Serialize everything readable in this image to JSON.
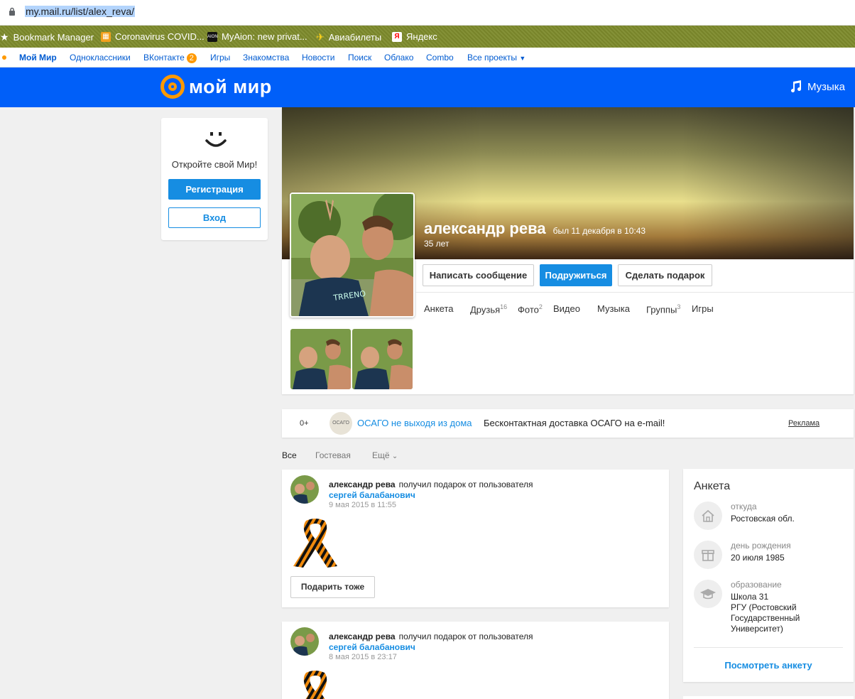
{
  "browser": {
    "url": "my.mail.ru/list/alex_reva/",
    "bookmarks": [
      {
        "label": "Bookmark Manager",
        "icon": "star-icon"
      },
      {
        "label": "Coronavirus COVID...",
        "icon": "covid-icon"
      },
      {
        "label": "MyAion: new privat...",
        "icon": "aion-icon"
      },
      {
        "label": "Авиабилеты",
        "icon": "plane-icon"
      },
      {
        "label": "Яндекс",
        "icon": "yandex-icon"
      }
    ]
  },
  "portal": {
    "links": [
      "Мой Мир",
      "Одноклассники",
      "ВКонтакте",
      "Игры",
      "Знакомства",
      "Новости",
      "Поиск",
      "Облако",
      "Combo",
      "Все проекты"
    ],
    "vk_badge": "2"
  },
  "header": {
    "logo_text": "мой мир",
    "music_label": "Музыка"
  },
  "reg_card": {
    "text": "Откройте свой Мир!",
    "register_label": "Регистрация",
    "login_label": "Вход"
  },
  "profile": {
    "name": "александр рева",
    "last_seen": "был 11 декабря в 10:43",
    "age": "35 лет",
    "actions": {
      "message": "Написать сообщение",
      "befriend": "Подружиться",
      "gift": "Сделать подарок"
    },
    "tabs": [
      {
        "label": "Анкета",
        "count": ""
      },
      {
        "label": "Друзья",
        "count": "16"
      },
      {
        "label": "Фото",
        "count": "2"
      },
      {
        "label": "Видео",
        "count": ""
      },
      {
        "label": "Музыка",
        "count": ""
      },
      {
        "label": "Группы",
        "count": "3"
      },
      {
        "label": "Игры",
        "count": ""
      }
    ]
  },
  "ad": {
    "age_limit": "0+",
    "title": "ОСАГО не выходя из дома",
    "description": "Бесконтактная доставка ОСАГО на e-mail!",
    "reklama": "Реклама"
  },
  "feed_filters": {
    "all": "Все",
    "guestbook": "Гостевая",
    "more": "Ещё"
  },
  "posts": [
    {
      "author": "александр рева",
      "action": "получил подарок от пользователя",
      "friend": "сергей балабанович",
      "date": "9 мая 2015 в 11:55",
      "gift_button": "Подарить тоже"
    },
    {
      "author": "александр рева",
      "action": "получил подарок от пользователя",
      "friend": "сергей балабанович",
      "date": "8 мая 2015 в 23:17"
    }
  ],
  "info_card": {
    "title": "Анкета",
    "rows": [
      {
        "label": "откуда",
        "value": "Ростовская обл.",
        "icon": "home-icon"
      },
      {
        "label": "день рождения",
        "value": "20 июля 1985",
        "icon": "gift-icon"
      },
      {
        "label": "образование",
        "value": "Школа 31\nРГУ (Ростовский Государственный Университет)",
        "icon": "graduation-cap-icon"
      }
    ],
    "view_more": "Посмотреть анкету"
  },
  "colors": {
    "brand_blue": "#005ff9",
    "button_blue": "#168de2",
    "accent_orange": "#ff9900"
  }
}
